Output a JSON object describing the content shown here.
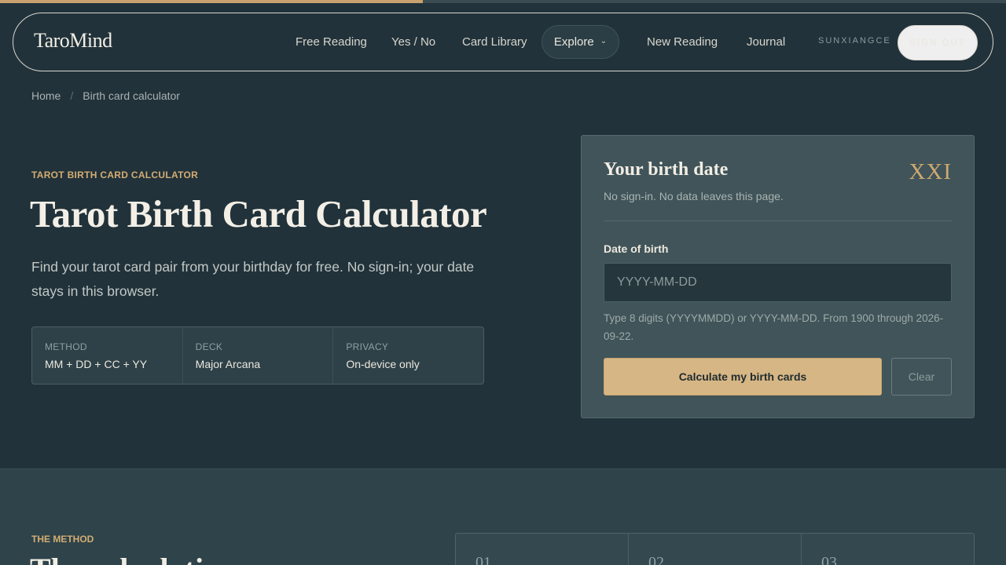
{
  "progress": {
    "value": 0.42,
    "accent": "#c9a16e"
  },
  "header": {
    "logo": "TaroMind",
    "nav": {
      "free_reading": "Free Reading",
      "yes_no": "Yes / No",
      "card_library": "Card Library",
      "explore": "Explore",
      "new_reading": "New Reading",
      "journal": "Journal"
    },
    "username": "SUNXIANGCE",
    "sign_out": "SIGN OUT"
  },
  "breadcrumb": {
    "home": "Home",
    "separator": "/",
    "current": "Birth card calculator"
  },
  "hero": {
    "eyebrow": "TAROT BIRTH CARD CALCULATOR",
    "title": "Tarot Birth Card Calculator",
    "subtitle": "Find your tarot card pair from your birthday for free. No sign-in; your date stays in this browser.",
    "facts": [
      {
        "key": "METHOD",
        "value": "MM + DD + CC + YY"
      },
      {
        "key": "DECK",
        "value": "Major Arcana"
      },
      {
        "key": "PRIVACY",
        "value": "On-device only"
      }
    ]
  },
  "card": {
    "title": "Your birth date",
    "numeral": "XXI",
    "note": "No sign-in. No data leaves this page.",
    "field_label": "Date of birth",
    "placeholder": "YYYY-MM-DD",
    "value": "",
    "hint": "Type 8 digits (YYYYMMDD) or YYYY-MM-DD. From 1900 through 2026-09-22.",
    "calculate": "Calculate my birth cards",
    "clear": "Clear"
  },
  "method": {
    "eyebrow": "THE METHOD",
    "title": "The calculation",
    "steps": [
      "01",
      "02",
      "03"
    ]
  },
  "colors": {
    "background": "#21323a",
    "accent_gold": "#d4ad73",
    "button_gold": "#d6b684",
    "card_bg": "#405459"
  }
}
